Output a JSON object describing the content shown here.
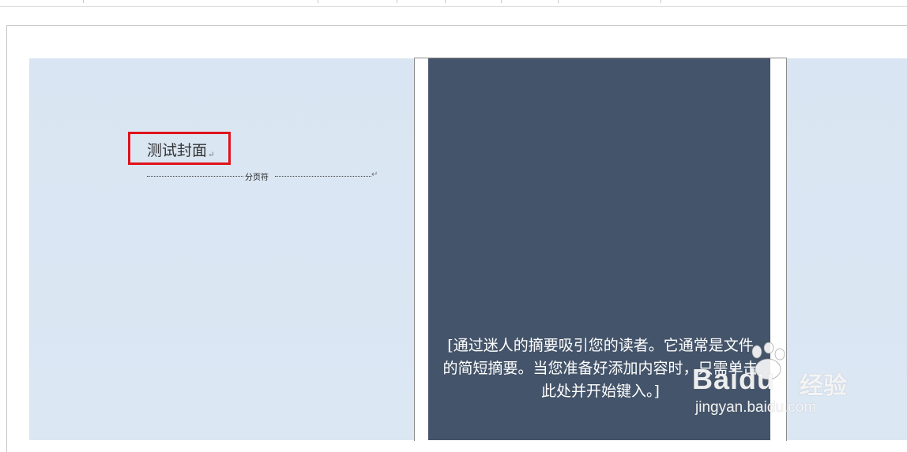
{
  "document": {
    "title_text": "测试封面",
    "paragraph_mark": "↵",
    "page_break_label": "分页符",
    "cover_abstract": "[通过迷人的摘要吸引您的读者。它通常是文件的简短摘要。当您准备好添加内容时，只需单击此处并开始键入。]"
  },
  "watermark": {
    "brand": "Bai",
    "brand_suffix": "du",
    "brand_cn": "经验",
    "url": "jingyan.baidu.com"
  },
  "colors": {
    "page_color": "#dbe6f3",
    "cover_panel": "#44546a",
    "highlight": "#e0121b"
  }
}
